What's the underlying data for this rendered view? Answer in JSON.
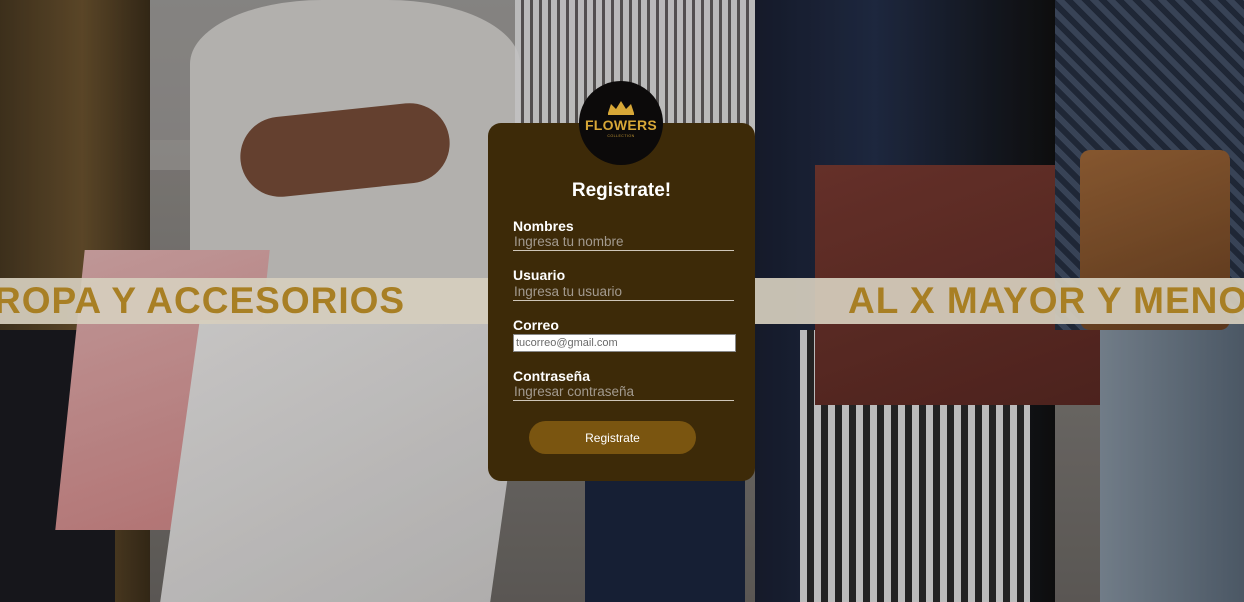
{
  "banner": {
    "left_text": "ROPA Y ACCESORIOS",
    "right_text": "AL X MAYOR Y MENO"
  },
  "logo": {
    "name": "FLOWERS",
    "subtitle": "COLLECTION"
  },
  "form": {
    "title": "Registrate!",
    "fields": [
      {
        "label": "Nombres",
        "placeholder": "Ingresa tu nombre"
      },
      {
        "label": "Usuario",
        "placeholder": "Ingresa tu usuario"
      },
      {
        "label": "Correo",
        "placeholder": "tucorreo@gmail.com"
      },
      {
        "label": "Contraseña",
        "placeholder": "Ingresar contraseña"
      }
    ],
    "submit_label": "Registrate"
  },
  "colors": {
    "card": "#3d2a08",
    "button": "#7a5510",
    "banner_text": "#a87f24",
    "logo_gold": "#d7a737"
  }
}
